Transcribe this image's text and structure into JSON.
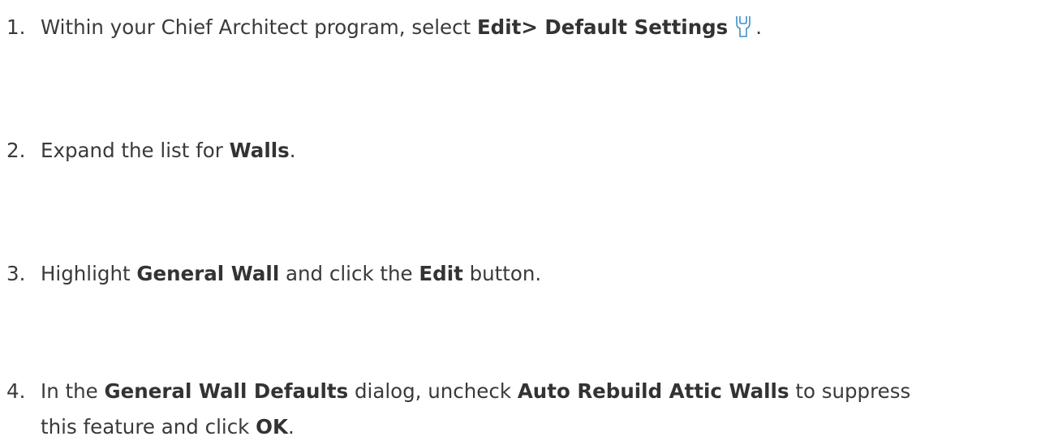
{
  "steps": [
    {
      "number": "1.",
      "text_before": "Within your Chief Architect program, select ",
      "bold1": "Edit> Default Settings",
      "icon": "wrench-icon",
      "text_after": "."
    },
    {
      "number": "2.",
      "text_before": "Expand the list for ",
      "bold1": "Walls",
      "text_after": "."
    },
    {
      "number": "3.",
      "text_before": "Highlight ",
      "bold1": "General Wall",
      "text_mid": " and click the ",
      "bold2": "Edit",
      "text_after": " button."
    },
    {
      "number": "4.",
      "text_before": "In the ",
      "bold1": "General Wall Defaults",
      "text_mid": " dialog, uncheck ",
      "bold2": "Auto Rebuild Attic Walls",
      "text_mid2": " to suppress",
      "text_line2_before": "this feature and click ",
      "bold3": "OK",
      "text_after": "."
    }
  ],
  "colors": {
    "text": "#3a3a3a",
    "icon_stroke": "#3d8fc7"
  }
}
